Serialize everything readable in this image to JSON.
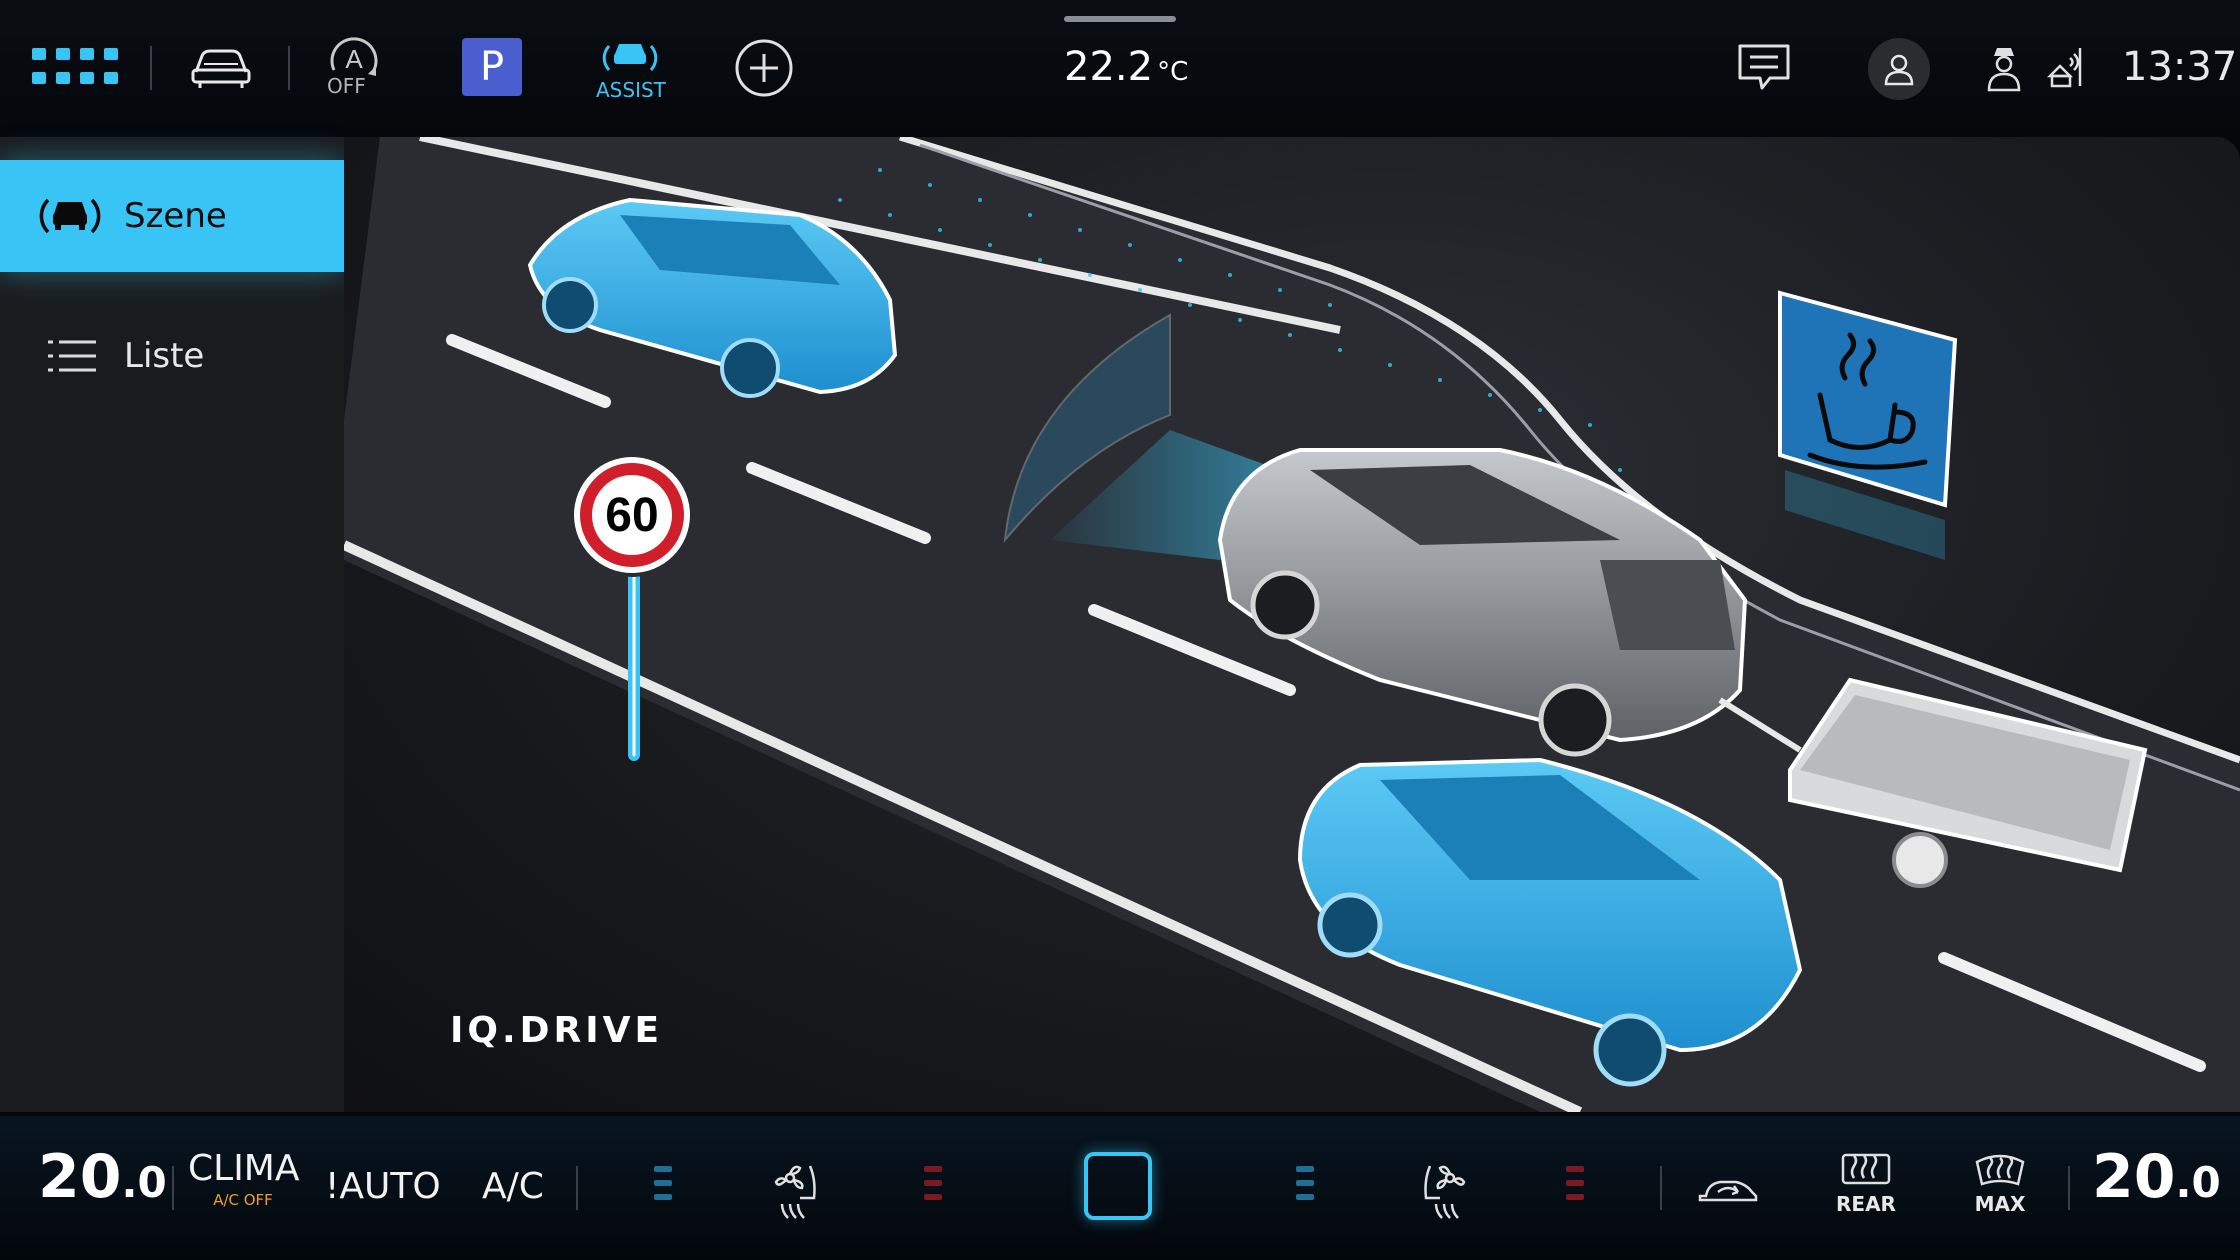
{
  "top_bar": {
    "apps_icon": "grid-icon",
    "car_icon": "car-front-icon",
    "auto_hold": {
      "label": "OFF"
    },
    "park": {
      "label": "P"
    },
    "assist": {
      "label": "ASSIST"
    },
    "add_icon": "plus-circle-icon",
    "outside_temp": {
      "value": "22.2",
      "unit": "°C"
    },
    "message_icon": "message-icon",
    "profile_icon": "profile-icon",
    "driver_icon": "driver-icon",
    "connectivity_icon": "connectivity-icon",
    "time": "13:37"
  },
  "sidebar": {
    "items": [
      {
        "label": "Szene",
        "icon": "car-assist-icon",
        "active": true
      },
      {
        "label": "Liste",
        "icon": "list-icon",
        "active": false
      }
    ]
  },
  "scene": {
    "speed_limit": "60",
    "brand": "IQ.DRIVE",
    "rest_stop_icon": "coffee-cup-icon"
  },
  "bottom_bar": {
    "left_temp": {
      "int": "20",
      "dec": ".0"
    },
    "clima": {
      "label": "CLIMA",
      "sub": "A/C OFF"
    },
    "auto": {
      "label": "!AUTO"
    },
    "ac": {
      "label": "A/C"
    },
    "rear": {
      "label": "REAR"
    },
    "max": {
      "label": "MAX"
    },
    "right_temp": {
      "int": "20",
      "dec": ".0"
    }
  },
  "colors": {
    "accent": "#38c5f5",
    "parking_blue": "#4a5ed0",
    "warning_orange": "#f0a020",
    "heat_red": "#7a1a22",
    "sidebar_bg": "#1a1b1d"
  }
}
